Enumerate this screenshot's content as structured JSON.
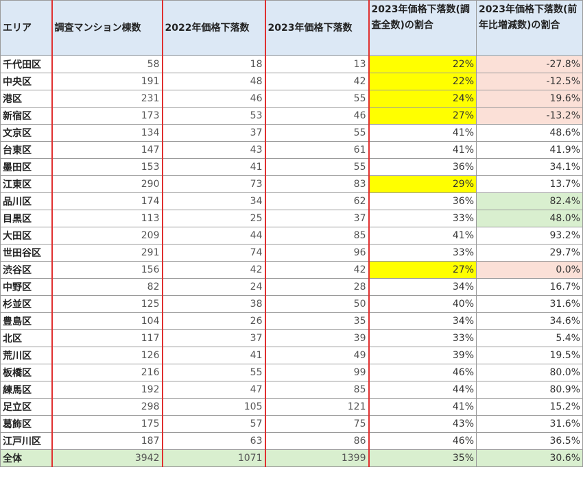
{
  "colors": {
    "header_bg": "#dce8f5",
    "yellow": "#ffff00",
    "pink": "#fbe0d7",
    "green": "#d9efcf",
    "red_line": "#e03030"
  },
  "headers": [
    "エリア",
    "調査マンション棟数",
    "2022年価格下落数",
    "2023年価格下落数",
    "2023年価格下落数(調査全数)の割合",
    "2023年価格下落数(前年比増減数)の割合"
  ],
  "rows": [
    {
      "area": "千代田区",
      "surveyed": "58",
      "down2022": "18",
      "down2023": "13",
      "ratio": "22%",
      "change": "-27.8%",
      "ratio_hl": "yellow",
      "change_hl": "pink"
    },
    {
      "area": "中央区",
      "surveyed": "191",
      "down2022": "48",
      "down2023": "42",
      "ratio": "22%",
      "change": "-12.5%",
      "ratio_hl": "yellow",
      "change_hl": "pink"
    },
    {
      "area": "港区",
      "surveyed": "231",
      "down2022": "46",
      "down2023": "55",
      "ratio": "24%",
      "change": "19.6%",
      "ratio_hl": "yellow",
      "change_hl": "pink"
    },
    {
      "area": "新宿区",
      "surveyed": "173",
      "down2022": "53",
      "down2023": "46",
      "ratio": "27%",
      "change": "-13.2%",
      "ratio_hl": "yellow",
      "change_hl": "pink"
    },
    {
      "area": "文京区",
      "surveyed": "134",
      "down2022": "37",
      "down2023": "55",
      "ratio": "41%",
      "change": "48.6%",
      "ratio_hl": "",
      "change_hl": ""
    },
    {
      "area": "台東区",
      "surveyed": "147",
      "down2022": "43",
      "down2023": "61",
      "ratio": "41%",
      "change": "41.9%",
      "ratio_hl": "",
      "change_hl": ""
    },
    {
      "area": "墨田区",
      "surveyed": "153",
      "down2022": "41",
      "down2023": "55",
      "ratio": "36%",
      "change": "34.1%",
      "ratio_hl": "",
      "change_hl": ""
    },
    {
      "area": "江東区",
      "surveyed": "290",
      "down2022": "73",
      "down2023": "83",
      "ratio": "29%",
      "change": "13.7%",
      "ratio_hl": "yellow",
      "change_hl": ""
    },
    {
      "area": "品川区",
      "surveyed": "174",
      "down2022": "34",
      "down2023": "62",
      "ratio": "36%",
      "change": "82.4%",
      "ratio_hl": "",
      "change_hl": "green"
    },
    {
      "area": "目黒区",
      "surveyed": "113",
      "down2022": "25",
      "down2023": "37",
      "ratio": "33%",
      "change": "48.0%",
      "ratio_hl": "",
      "change_hl": "green"
    },
    {
      "area": "大田区",
      "surveyed": "209",
      "down2022": "44",
      "down2023": "85",
      "ratio": "41%",
      "change": "93.2%",
      "ratio_hl": "",
      "change_hl": ""
    },
    {
      "area": "世田谷区",
      "surveyed": "291",
      "down2022": "74",
      "down2023": "96",
      "ratio": "33%",
      "change": "29.7%",
      "ratio_hl": "",
      "change_hl": ""
    },
    {
      "area": "渋谷区",
      "surveyed": "156",
      "down2022": "42",
      "down2023": "42",
      "ratio": "27%",
      "change": "0.0%",
      "ratio_hl": "yellow",
      "change_hl": "pink"
    },
    {
      "area": "中野区",
      "surveyed": "82",
      "down2022": "24",
      "down2023": "28",
      "ratio": "34%",
      "change": "16.7%",
      "ratio_hl": "",
      "change_hl": ""
    },
    {
      "area": "杉並区",
      "surveyed": "125",
      "down2022": "38",
      "down2023": "50",
      "ratio": "40%",
      "change": "31.6%",
      "ratio_hl": "",
      "change_hl": ""
    },
    {
      "area": "豊島区",
      "surveyed": "104",
      "down2022": "26",
      "down2023": "35",
      "ratio": "34%",
      "change": "34.6%",
      "ratio_hl": "",
      "change_hl": ""
    },
    {
      "area": "北区",
      "surveyed": "117",
      "down2022": "37",
      "down2023": "39",
      "ratio": "33%",
      "change": "5.4%",
      "ratio_hl": "",
      "change_hl": ""
    },
    {
      "area": "荒川区",
      "surveyed": "126",
      "down2022": "41",
      "down2023": "49",
      "ratio": "39%",
      "change": "19.5%",
      "ratio_hl": "",
      "change_hl": ""
    },
    {
      "area": "板橋区",
      "surveyed": "216",
      "down2022": "55",
      "down2023": "99",
      "ratio": "46%",
      "change": "80.0%",
      "ratio_hl": "",
      "change_hl": ""
    },
    {
      "area": "練馬区",
      "surveyed": "192",
      "down2022": "47",
      "down2023": "85",
      "ratio": "44%",
      "change": "80.9%",
      "ratio_hl": "",
      "change_hl": ""
    },
    {
      "area": "足立区",
      "surveyed": "298",
      "down2022": "105",
      "down2023": "121",
      "ratio": "41%",
      "change": "15.2%",
      "ratio_hl": "",
      "change_hl": ""
    },
    {
      "area": "葛飾区",
      "surveyed": "175",
      "down2022": "57",
      "down2023": "75",
      "ratio": "43%",
      "change": "31.6%",
      "ratio_hl": "",
      "change_hl": ""
    },
    {
      "area": "江戸川区",
      "surveyed": "187",
      "down2022": "63",
      "down2023": "86",
      "ratio": "46%",
      "change": "36.5%",
      "ratio_hl": "",
      "change_hl": ""
    }
  ],
  "total": {
    "area": "全体",
    "surveyed": "3942",
    "down2022": "1071",
    "down2023": "1399",
    "ratio": "35%",
    "change": "30.6%"
  }
}
